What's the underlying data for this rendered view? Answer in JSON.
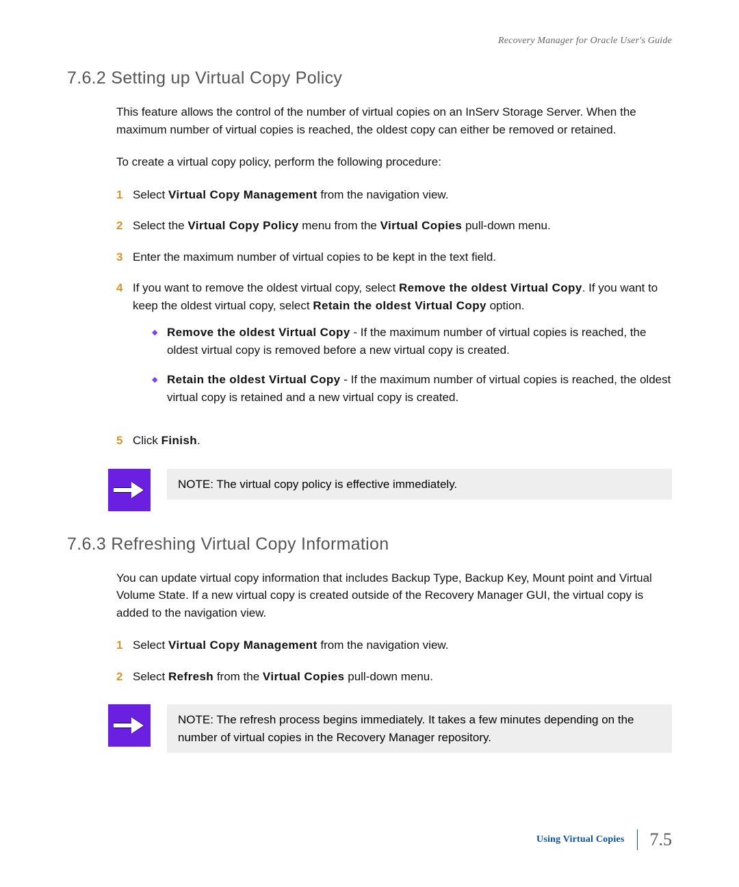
{
  "running_header": "Recovery Manager for Oracle User's Guide",
  "section1": {
    "heading": "7.6.2 Setting up Virtual Copy Policy",
    "intro": "This feature allows the control of the number of virtual copies on an InServ Storage Server. When the maximum number of virtual copies is reached, the oldest copy can either be removed or retained.",
    "leadin": "To create a virtual copy policy, perform the following procedure:",
    "step1_a": "Select ",
    "step1_term": "Virtual Copy Management",
    "step1_b": " from the navigation view.",
    "step2_a": "Select the ",
    "step2_term1": "Virtual Copy Policy",
    "step2_b": " menu from the ",
    "step2_term2": "Virtual Copies",
    "step2_c": " pull-down menu.",
    "step3": "Enter the maximum number of virtual copies to be kept in the text field.",
    "step4_a": "If you want to remove the oldest virtual copy, select ",
    "step4_term1": "Remove the oldest Virtual Copy",
    "step4_b": ". If you want to keep the oldest virtual copy, select ",
    "step4_term2": "Retain the oldest Virtual Copy",
    "step4_c": " option.",
    "bullet1_term": "Remove the oldest Virtual Copy",
    "bullet1_text": " - If the maximum number of virtual copies is reached, the oldest virtual copy is removed before a new virtual copy is created.",
    "bullet2_term": "Retain the oldest Virtual Copy",
    "bullet2_text": " - If the maximum number of virtual copies is reached, the oldest virtual copy is retained and a new virtual copy is created.",
    "step5_a": "Click ",
    "step5_term": "Finish",
    "step5_b": ".",
    "note": "NOTE: The virtual copy policy is effective immediately."
  },
  "section2": {
    "heading": "7.6.3 Refreshing Virtual Copy Information",
    "intro": "You can update virtual copy information that includes Backup Type, Backup Key, Mount point and Virtual Volume State. If a new virtual copy is created outside of the Recovery Manager GUI, the virtual copy is added to the navigation view.",
    "step1_a": "Select ",
    "step1_term": "Virtual Copy Management",
    "step1_b": " from the navigation view.",
    "step2_a": "Select ",
    "step2_term1": "Refresh",
    "step2_b": " from the ",
    "step2_term2": "Virtual Copies",
    "step2_c": " pull-down menu.",
    "note": "NOTE: The refresh process begins immediately. It takes a few minutes depending on the number of virtual copies in the Recovery Manager repository."
  },
  "footer": {
    "label": "Using Virtual Copies",
    "page": "7.5"
  }
}
